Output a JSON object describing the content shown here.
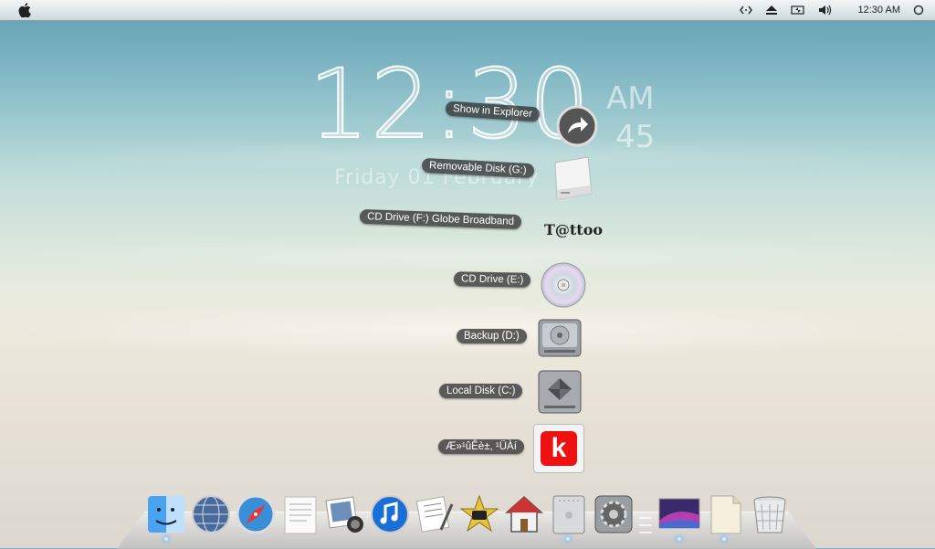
{
  "menubar": {
    "apple_icon": "apple-logo-icon",
    "time": "12:30 AM",
    "status_icons": [
      "code-brackets-icon",
      "eject-icon",
      "battery-icon",
      "volume-icon",
      "spotlight-icon"
    ]
  },
  "clock": {
    "time": "12:30",
    "ampm": "AM",
    "seconds": "45",
    "date": "Friday 01 February"
  },
  "stack": {
    "items": [
      {
        "label": "Show in Explorer",
        "icon": "arrow-circle-icon"
      },
      {
        "label": "Removable Disk (G:)",
        "icon": "removable-disk-icon"
      },
      {
        "label": "CD Drive (F:) Globe Broadband",
        "icon": "tattoo-logo-icon",
        "icon_text": "T@ttoo"
      },
      {
        "label": "CD Drive (E:)",
        "icon": "cd-icon"
      },
      {
        "label": "Backup (D:)",
        "icon": "hard-drive-icon"
      },
      {
        "label": "Local Disk (C:)",
        "icon": "windows-drive-icon"
      },
      {
        "label": "Æ»¹ûÊè±, ¹ÜÀí",
        "icon": "k-app-icon",
        "icon_text": "k"
      }
    ]
  },
  "dock": {
    "items": [
      "finder-icon",
      "network-icon",
      "safari-icon",
      "textedit-icon",
      "iphoto-icon",
      "itunes-icon",
      "script-editor-icon",
      "imovie-icon",
      "home-icon",
      "mac-pro-icon",
      "system-preferences-icon",
      "desktop-picture-icon",
      "documents-icon",
      "trash-icon"
    ]
  }
}
